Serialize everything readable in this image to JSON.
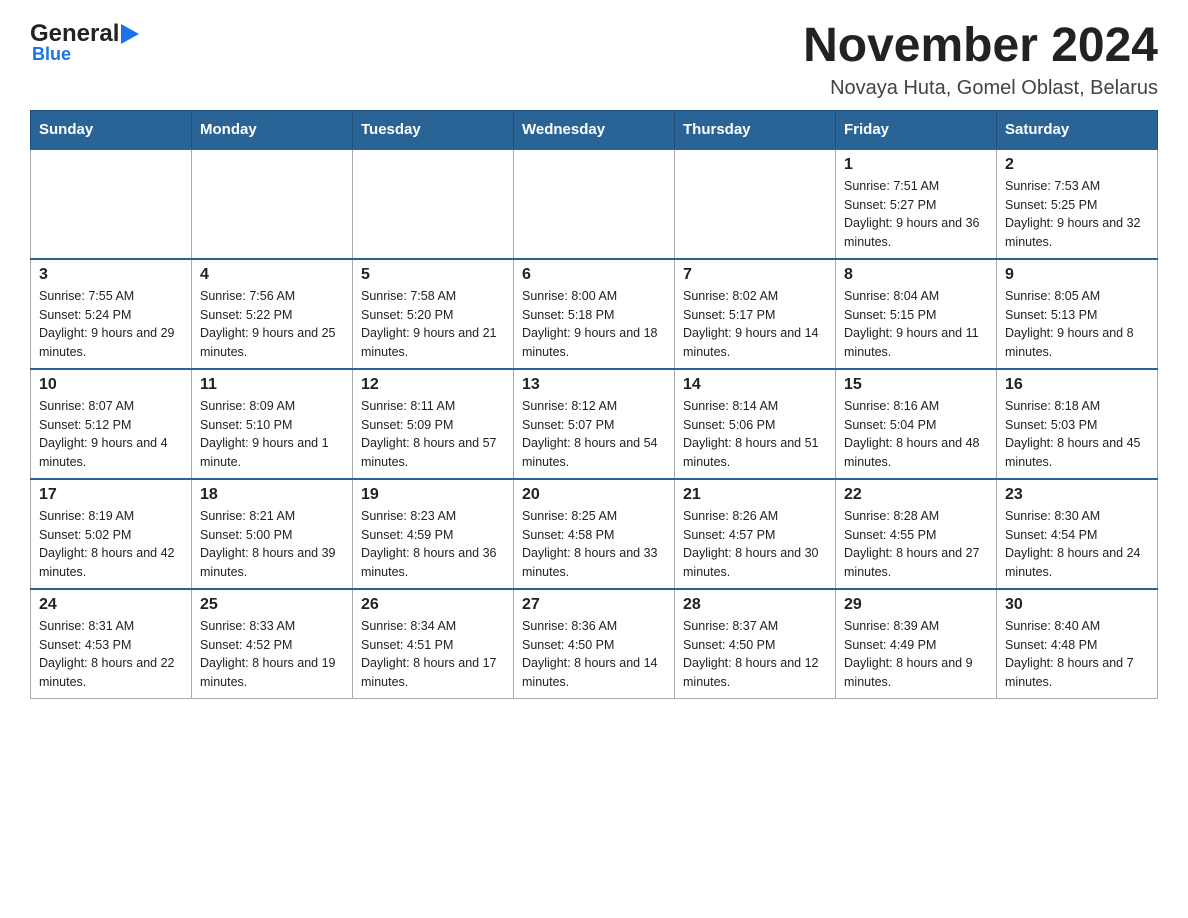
{
  "logo": {
    "general": "General",
    "blue": "Blue"
  },
  "header": {
    "title": "November 2024",
    "location": "Novaya Huta, Gomel Oblast, Belarus"
  },
  "days_of_week": [
    "Sunday",
    "Monday",
    "Tuesday",
    "Wednesday",
    "Thursday",
    "Friday",
    "Saturday"
  ],
  "weeks": [
    [
      {
        "day": "",
        "info": ""
      },
      {
        "day": "",
        "info": ""
      },
      {
        "day": "",
        "info": ""
      },
      {
        "day": "",
        "info": ""
      },
      {
        "day": "",
        "info": ""
      },
      {
        "day": "1",
        "info": "Sunrise: 7:51 AM\nSunset: 5:27 PM\nDaylight: 9 hours and 36 minutes."
      },
      {
        "day": "2",
        "info": "Sunrise: 7:53 AM\nSunset: 5:25 PM\nDaylight: 9 hours and 32 minutes."
      }
    ],
    [
      {
        "day": "3",
        "info": "Sunrise: 7:55 AM\nSunset: 5:24 PM\nDaylight: 9 hours and 29 minutes."
      },
      {
        "day": "4",
        "info": "Sunrise: 7:56 AM\nSunset: 5:22 PM\nDaylight: 9 hours and 25 minutes."
      },
      {
        "day": "5",
        "info": "Sunrise: 7:58 AM\nSunset: 5:20 PM\nDaylight: 9 hours and 21 minutes."
      },
      {
        "day": "6",
        "info": "Sunrise: 8:00 AM\nSunset: 5:18 PM\nDaylight: 9 hours and 18 minutes."
      },
      {
        "day": "7",
        "info": "Sunrise: 8:02 AM\nSunset: 5:17 PM\nDaylight: 9 hours and 14 minutes."
      },
      {
        "day": "8",
        "info": "Sunrise: 8:04 AM\nSunset: 5:15 PM\nDaylight: 9 hours and 11 minutes."
      },
      {
        "day": "9",
        "info": "Sunrise: 8:05 AM\nSunset: 5:13 PM\nDaylight: 9 hours and 8 minutes."
      }
    ],
    [
      {
        "day": "10",
        "info": "Sunrise: 8:07 AM\nSunset: 5:12 PM\nDaylight: 9 hours and 4 minutes."
      },
      {
        "day": "11",
        "info": "Sunrise: 8:09 AM\nSunset: 5:10 PM\nDaylight: 9 hours and 1 minute."
      },
      {
        "day": "12",
        "info": "Sunrise: 8:11 AM\nSunset: 5:09 PM\nDaylight: 8 hours and 57 minutes."
      },
      {
        "day": "13",
        "info": "Sunrise: 8:12 AM\nSunset: 5:07 PM\nDaylight: 8 hours and 54 minutes."
      },
      {
        "day": "14",
        "info": "Sunrise: 8:14 AM\nSunset: 5:06 PM\nDaylight: 8 hours and 51 minutes."
      },
      {
        "day": "15",
        "info": "Sunrise: 8:16 AM\nSunset: 5:04 PM\nDaylight: 8 hours and 48 minutes."
      },
      {
        "day": "16",
        "info": "Sunrise: 8:18 AM\nSunset: 5:03 PM\nDaylight: 8 hours and 45 minutes."
      }
    ],
    [
      {
        "day": "17",
        "info": "Sunrise: 8:19 AM\nSunset: 5:02 PM\nDaylight: 8 hours and 42 minutes."
      },
      {
        "day": "18",
        "info": "Sunrise: 8:21 AM\nSunset: 5:00 PM\nDaylight: 8 hours and 39 minutes."
      },
      {
        "day": "19",
        "info": "Sunrise: 8:23 AM\nSunset: 4:59 PM\nDaylight: 8 hours and 36 minutes."
      },
      {
        "day": "20",
        "info": "Sunrise: 8:25 AM\nSunset: 4:58 PM\nDaylight: 8 hours and 33 minutes."
      },
      {
        "day": "21",
        "info": "Sunrise: 8:26 AM\nSunset: 4:57 PM\nDaylight: 8 hours and 30 minutes."
      },
      {
        "day": "22",
        "info": "Sunrise: 8:28 AM\nSunset: 4:55 PM\nDaylight: 8 hours and 27 minutes."
      },
      {
        "day": "23",
        "info": "Sunrise: 8:30 AM\nSunset: 4:54 PM\nDaylight: 8 hours and 24 minutes."
      }
    ],
    [
      {
        "day": "24",
        "info": "Sunrise: 8:31 AM\nSunset: 4:53 PM\nDaylight: 8 hours and 22 minutes."
      },
      {
        "day": "25",
        "info": "Sunrise: 8:33 AM\nSunset: 4:52 PM\nDaylight: 8 hours and 19 minutes."
      },
      {
        "day": "26",
        "info": "Sunrise: 8:34 AM\nSunset: 4:51 PM\nDaylight: 8 hours and 17 minutes."
      },
      {
        "day": "27",
        "info": "Sunrise: 8:36 AM\nSunset: 4:50 PM\nDaylight: 8 hours and 14 minutes."
      },
      {
        "day": "28",
        "info": "Sunrise: 8:37 AM\nSunset: 4:50 PM\nDaylight: 8 hours and 12 minutes."
      },
      {
        "day": "29",
        "info": "Sunrise: 8:39 AM\nSunset: 4:49 PM\nDaylight: 8 hours and 9 minutes."
      },
      {
        "day": "30",
        "info": "Sunrise: 8:40 AM\nSunset: 4:48 PM\nDaylight: 8 hours and 7 minutes."
      }
    ]
  ]
}
